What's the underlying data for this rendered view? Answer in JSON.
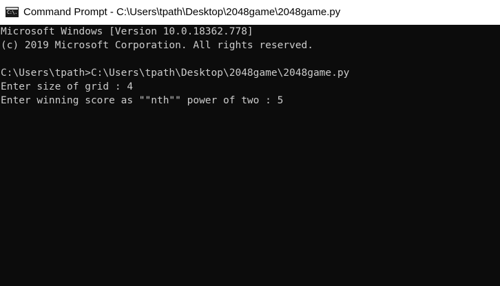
{
  "window": {
    "title": "Command Prompt - C:\\Users\\tpath\\Desktop\\2048game\\2048game.py",
    "icon": "cmd-icon",
    "icon_glyph": "C:\\."
  },
  "console": {
    "lines": [
      "Microsoft Windows [Version 10.0.18362.778]",
      "(c) 2019 Microsoft Corporation. All rights reserved.",
      "",
      "C:\\Users\\tpath>C:\\Users\\tpath\\Desktop\\2048game\\2048game.py",
      "Enter size of grid : 4",
      "Enter winning score as \"\"nth\"\" power of two : 5"
    ],
    "background": "#0c0c0c",
    "text_color": "#cccccc"
  }
}
